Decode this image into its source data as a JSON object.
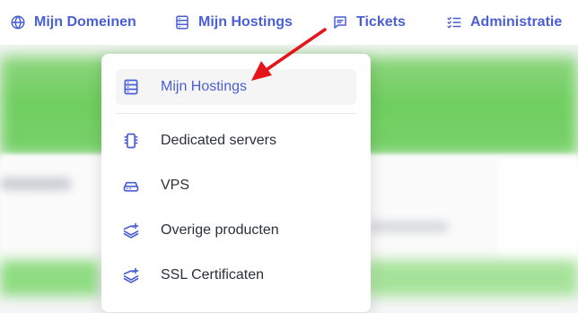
{
  "nav": {
    "items": [
      {
        "label": "Mijn Domeinen",
        "icon": "globe-icon"
      },
      {
        "label": "Mijn Hostings",
        "icon": "server-icon"
      },
      {
        "label": "Tickets",
        "icon": "ticket-chat-icon"
      },
      {
        "label": "Administratie",
        "icon": "list-check-icon"
      }
    ]
  },
  "dropdown": {
    "items": [
      {
        "label": "Mijn Hostings",
        "icon": "server-icon",
        "active": true
      },
      {
        "label": "Dedicated servers",
        "icon": "server-chip-icon"
      },
      {
        "label": "VPS",
        "icon": "hard-drive-icon"
      },
      {
        "label": "Overige producten",
        "icon": "layers-plus-icon"
      },
      {
        "label": "SSL Certificaten",
        "icon": "layers-plus-icon"
      }
    ]
  },
  "colors": {
    "accent": "#4a5fd6",
    "text": "#2a3038",
    "annotation_arrow": "#e3151a",
    "active_bg": "#f5f5f5"
  }
}
